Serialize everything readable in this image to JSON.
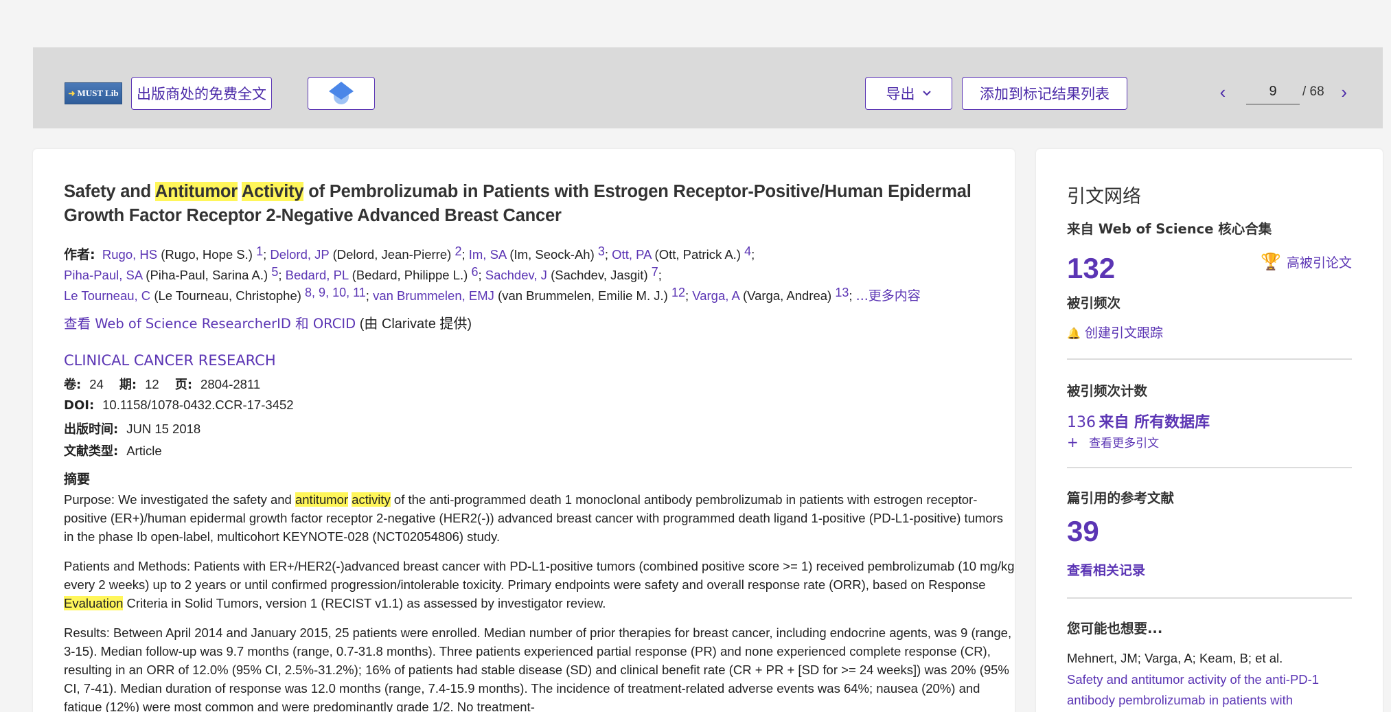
{
  "toolbar": {
    "lib_logo": "MUST Lib",
    "free_fulltext": "出版商处的免费全文",
    "export": "导出",
    "add_marked": "添加到标记结果列表",
    "current_page": "9",
    "total_pages": "/ 68"
  },
  "record": {
    "title_parts": [
      "Safety and ",
      "Antitumor",
      " ",
      "Activity",
      " of Pembrolizumab in Patients with Estrogen Receptor-Positive/Human Epidermal Growth Factor Receptor 2-Negative Advanced Breast Cancer"
    ],
    "authors_label": "作者:",
    "authors": [
      {
        "short": "Rugo, HS",
        "full": "(Rugo, Hope S.)",
        "num": "1"
      },
      {
        "short": "Delord, JP",
        "full": "(Delord, Jean-Pierre)",
        "num": "2"
      },
      {
        "short": "Im, SA",
        "full": "(Im, Seock-Ah)",
        "num": "3"
      },
      {
        "short": "Ott, PA",
        "full": "(Ott, Patrick A.)",
        "num": "4"
      },
      {
        "short": "Piha-Paul, SA",
        "full": "(Piha-Paul, Sarina A.)",
        "num": "5"
      },
      {
        "short": "Bedard, PL",
        "full": "(Bedard, Philippe L.)",
        "num": "6"
      },
      {
        "short": "Sachdev, J",
        "full": "(Sachdev, Jasgit)",
        "num": "7"
      },
      {
        "short": "Le Tourneau, C",
        "full": "(Le Tourneau, Christophe)",
        "num": "8, 9, 10, 11"
      },
      {
        "short": "van Brummelen, EMJ",
        "full": "(van Brummelen, Emilie M. J.)",
        "num": "12"
      },
      {
        "short": "Varga, A",
        "full": "(Varga, Andrea)",
        "num": "13"
      }
    ],
    "more": "...更多内容",
    "researcher_link": "查看 Web of Science ResearcherID 和 ORCID",
    "researcher_note": "(由 Clarivate 提供)",
    "journal": "CLINICAL CANCER RESEARCH",
    "volume_label": "卷:",
    "volume": "24",
    "issue_label": "期:",
    "issue": "12",
    "pages_label": "页:",
    "pages": "2804-2811",
    "doi_label": "DOI:",
    "doi": "10.1158/1078-0432.CCR-17-3452",
    "pubdate_label": "出版时间:",
    "pubdate": "JUN 15 2018",
    "doctype_label": "文献类型:",
    "doctype": "Article",
    "abstract_label": "摘要",
    "abstract_p1_parts": [
      "Purpose: We investigated the safety and ",
      "antitumor",
      " ",
      "activity",
      " of the anti-programmed death 1 monoclonal antibody pembrolizumab in patients with estrogen receptor-positive (ER+)/human epidermal growth factor receptor 2-negative (HER2(-)) advanced breast cancer with programmed death ligand 1-positive (PD-L1-positive) tumors in the phase Ib open-label, multicohort KEYNOTE-028 (NCT02054806) study."
    ],
    "abstract_p2_parts": [
      "Patients and Methods: Patients with ER+/HER2(-)advanced breast cancer with PD-L1-positive tumors (combined positive score >= 1) received pembrolizumab (10 mg/kg every 2 weeks) up to 2 years or until confirmed progression/intolerable toxicity. Primary endpoints were safety and overall response rate (ORR), based on Response ",
      "Evaluation",
      " Criteria in Solid Tumors, version 1 (RECIST v1.1) as assessed by investigator review."
    ],
    "abstract_p3": "Results: Between April 2014 and January 2015, 25 patients were enrolled. Median number of prior therapies for breast cancer, including endocrine agents, was 9 (range, 3-15). Median follow-up was 9.7 months (range, 0.7-31.8 months). Three patients experienced partial response (PR) and none experienced complete response (CR), resulting in an ORR of 12.0% (95% CI, 2.5%-31.2%); 16% of patients had stable disease (SD) and clinical benefit rate (CR + PR + [SD for >= 24 weeks]) was 20% (95% CI, 7-41). Median duration of response was 12.0 months (range, 7.4-15.9 months). The incidence of treatment-related adverse events was 64%; nausea (20%) and fatigue (12%) were most common and were predominantly grade 1/2. No treatment-"
  },
  "sidebar": {
    "title": "引文网络",
    "source": "来自 Web of Science 核心合集",
    "times_cited": "132",
    "times_cited_label": "被引频次",
    "highly_cited": "高被引论文",
    "create_alert": "创建引文跟踪",
    "cited_count_title": "被引频次计数",
    "all_db_count": "136",
    "all_db_label": "来自 所有数据库",
    "view_more": "查看更多引文",
    "refs_title": "篇引用的参考文献",
    "refs_count": "39",
    "view_related": "查看相关记录",
    "might_like": "您可能也想要...",
    "rec_authors": "Mehnert, JM; Varga, A; Keam, B; et al.",
    "rec_title": "Safety and antitumor activity of the anti-PD-1 antibody pembrolizumab in patients with"
  }
}
